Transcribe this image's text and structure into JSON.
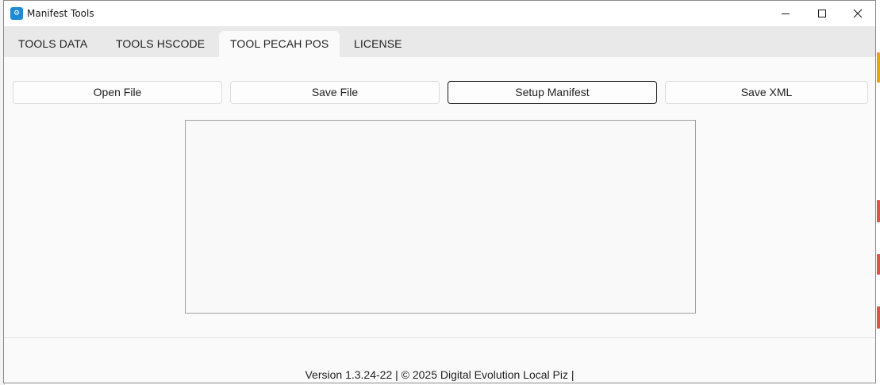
{
  "window": {
    "title": "Manifest Tools",
    "icon": "app-tool-icon",
    "controls": [
      "minimize-icon",
      "maximize-icon",
      "close-icon"
    ]
  },
  "tabs": [
    {
      "label": "TOOLS DATA",
      "active": false
    },
    {
      "label": "TOOLS HSCODE",
      "active": false
    },
    {
      "label": "TOOL PECAH POS",
      "active": true
    },
    {
      "label": "LICENSE",
      "active": false
    }
  ],
  "toolbar": {
    "open_label": "Open File",
    "save_label": "Save File",
    "setup_label": "Setup Manifest",
    "xml_label": "Save XML"
  },
  "footer": {
    "text": "Version 1.3.24-22 | © 2025 Digital Evolution Local Piz |"
  },
  "colors": {
    "tabbar_bg": "#e9e9e9",
    "window_bg": "#fafafa",
    "accent_icon": "#1f8bd6"
  }
}
